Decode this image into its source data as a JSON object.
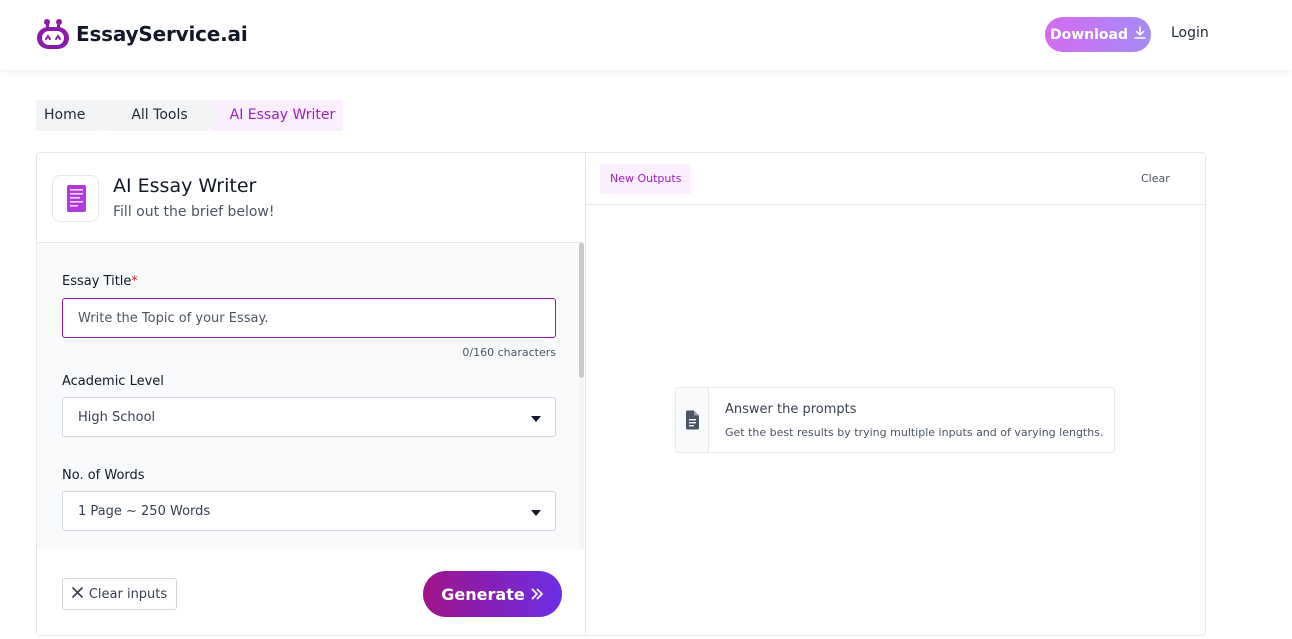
{
  "header": {
    "brand": "EssayService.ai",
    "download_label": "Download",
    "login_label": "Login"
  },
  "breadcrumb": [
    "Home",
    "All Tools",
    "AI Essay Writer"
  ],
  "tool": {
    "title": "AI Essay Writer",
    "subtitle": "Fill out the brief below!"
  },
  "form": {
    "essay_title": {
      "label": "Essay Title",
      "required_mark": "*",
      "value": "",
      "placeholder": "Write the Topic of your Essay.",
      "counter": "0/160 characters"
    },
    "academic_level": {
      "label": "Academic Level",
      "selected": "High School"
    },
    "word_count": {
      "label": "No. of Words",
      "selected": "1 Page ~ 250 Words"
    },
    "clear_label": "Clear inputs",
    "generate_label": "Generate"
  },
  "output": {
    "tab_label": "New Outputs",
    "clear_label": "Clear",
    "hint_title": "Answer the prompts",
    "hint_text": "Get the best results by trying multiple inputs and of varying lengths."
  },
  "icons": {
    "logo": "robot-logo-icon",
    "download": "download-arrow-icon",
    "tool": "document-icon",
    "clear": "close-icon",
    "generate": "double-chevron-right-icon",
    "hint": "file-text-icon"
  },
  "colors": {
    "brand_purple": "#9b1fbf",
    "generate_gradient_start": "#a0148a",
    "generate_gradient_end": "#6b2ee6",
    "download_gradient_start": "#d36cf0",
    "download_gradient_end": "#a58bf5",
    "accent_tint": "#fbefff"
  }
}
